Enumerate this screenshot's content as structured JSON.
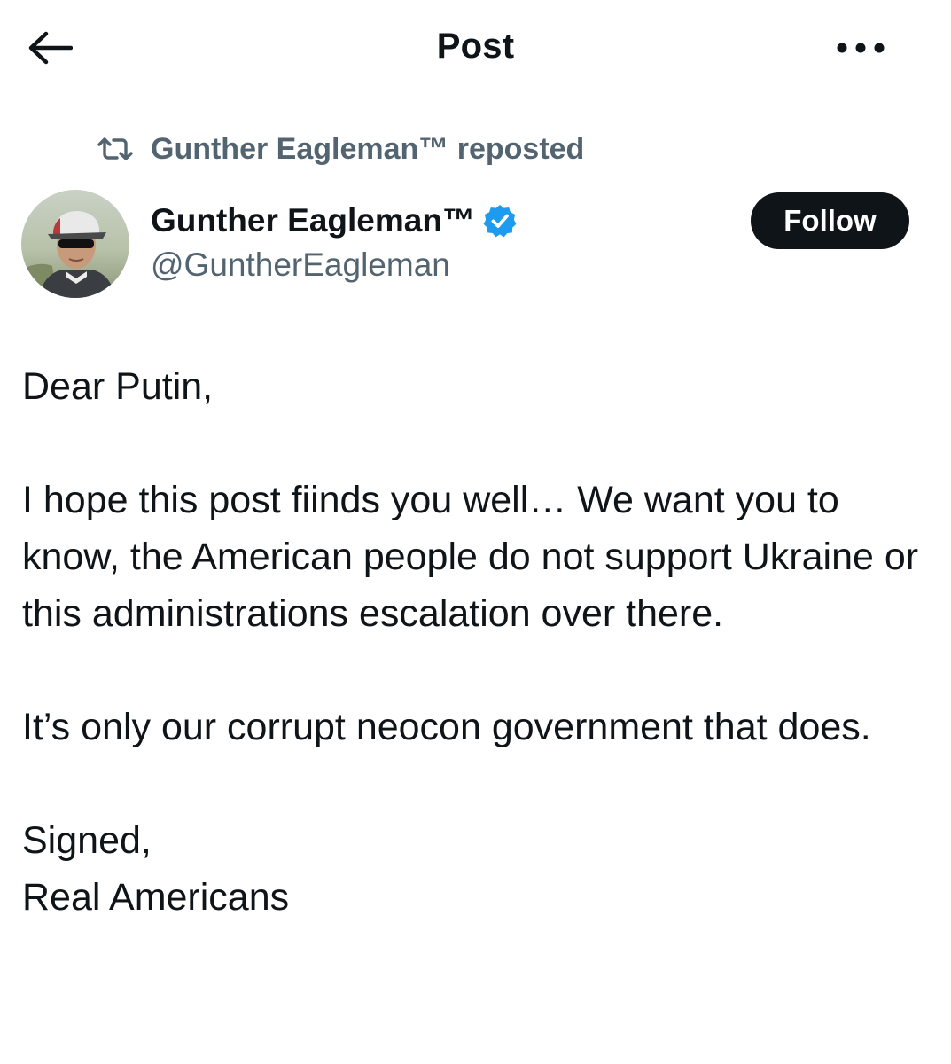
{
  "header": {
    "title": "Post",
    "back_icon": "arrow-left-icon",
    "more_icon": "more-horizontal-icon"
  },
  "repost": {
    "icon": "repost-icon",
    "text": "Gunther Eagleman™ reposted"
  },
  "author": {
    "display_name": "Gunther Eagleman™",
    "handle": "@GuntherEagleman",
    "verified": true,
    "verified_color": "#1d9bf0",
    "follow_label": "Follow"
  },
  "post": {
    "paragraphs": [
      "Dear Putin,",
      "I hope this post fiinds you well…  We want you to know,  the American people do not support Ukraine or this administrations escalation over there.",
      "It’s only our corrupt neocon government that does.",
      "Signed,",
      "Real Americans"
    ]
  },
  "colors": {
    "text_primary": "#0f1419",
    "text_secondary": "#536471",
    "follow_bg": "#0f1419",
    "follow_text": "#ffffff",
    "verified": "#1d9bf0"
  }
}
